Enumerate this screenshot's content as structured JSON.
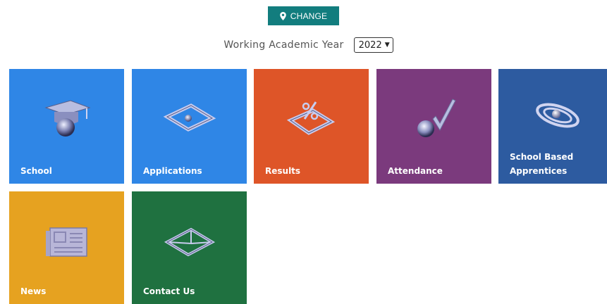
{
  "header": {
    "change_label": "CHANGE",
    "change_icon": "map-marker-icon",
    "year_label": "Working Academic Year",
    "year_value": "2022"
  },
  "tiles": [
    {
      "label": "School",
      "color": "#2f86e6",
      "icon": "graduation-cap-icon"
    },
    {
      "label": "Applications",
      "color": "#2f86e6",
      "icon": "diamond-frame-icon"
    },
    {
      "label": "Results",
      "color": "#de5528",
      "icon": "percent-icon"
    },
    {
      "label": "Attendance",
      "color": "#7b3a7d",
      "icon": "checkmark-ball-icon"
    },
    {
      "label": "School Based Apprentices",
      "color": "#2d5ba0",
      "icon": "orbit-rings-icon"
    },
    {
      "label": "News",
      "color": "#e6a220",
      "icon": "newspaper-icon"
    },
    {
      "label": "Contact Us",
      "color": "#1f7140",
      "icon": "envelope-icon"
    }
  ],
  "colors": {
    "accent": "#127d7e"
  }
}
